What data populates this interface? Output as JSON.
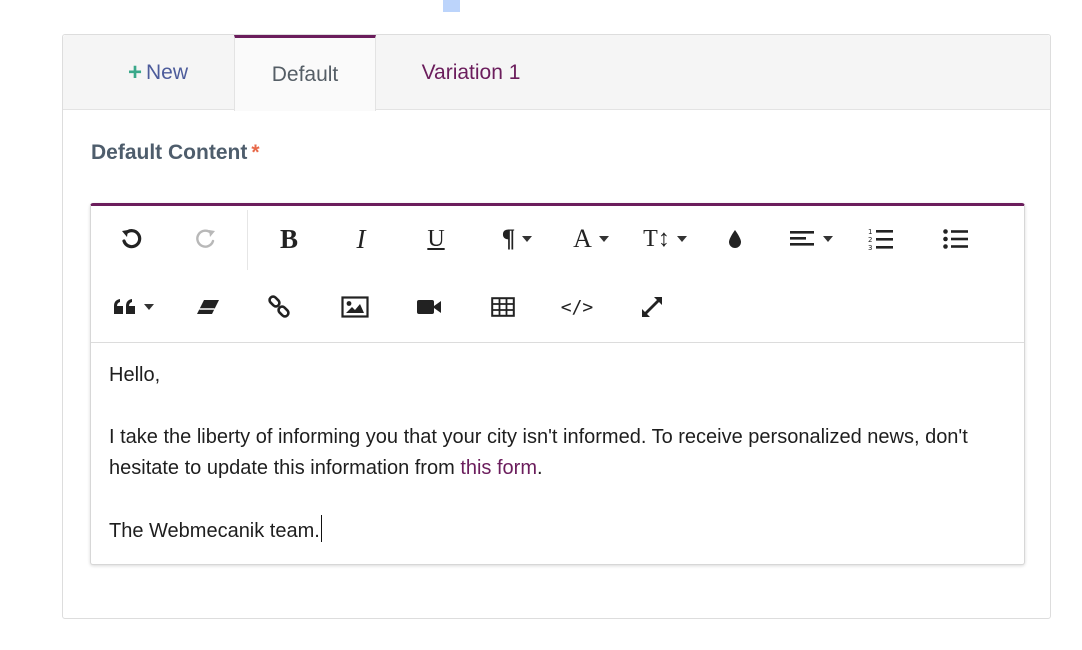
{
  "tabs": {
    "new_label": "New",
    "default_label": "Default",
    "variation_label": "Variation 1"
  },
  "field": {
    "label": "Default Content",
    "required_mark": "*"
  },
  "toolbar": {
    "row1": [
      "undo-icon",
      "redo-icon",
      "bold-icon",
      "italic-icon",
      "underline-icon",
      "paragraph-style-icon",
      "font-family-icon",
      "font-size-icon",
      "color-icon",
      "align-icon",
      "ordered-list-icon",
      "unordered-list-icon"
    ],
    "row2": [
      "blockquote-icon",
      "eraser-icon",
      "link-icon",
      "picture-icon",
      "video-icon",
      "table-icon",
      "code-view-icon",
      "fullscreen-icon"
    ],
    "bold_glyph": "B",
    "italic_glyph": "I",
    "underline_glyph": "U",
    "paragraph_glyph": "¶",
    "font_glyph": "A",
    "size_glyph": "T↕",
    "code_glyph": "</>"
  },
  "content": {
    "greeting": "Hello,",
    "body_before_link": "I take the liberty of informing you that your city isn't informed. To receive personalized news, don't hesitate to update this information from ",
    "link_text": "this form",
    "body_after_link": ".",
    "signature": "The Webmecanik team."
  },
  "colors": {
    "accent": "#6b1d5c",
    "plus": "#3aa88a",
    "required": "#e8694a",
    "label": "#4e5d6c"
  }
}
